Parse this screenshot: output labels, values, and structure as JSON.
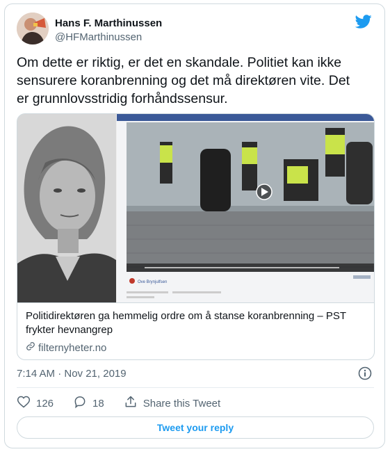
{
  "author": {
    "name": "Hans F. Marthinussen",
    "handle": "@HFMarthinussen"
  },
  "tweet": {
    "text": "Om dette er riktig, er det en skandale. Politiet kan ikke sensurere koranbrenning og det må direktøren vite. Det er grunnlovsstridig forhåndssensur."
  },
  "link_card": {
    "title": "Politidirektøren ga hemmelig ordre om å stanse koranbrenning – PST frykter hevnangrep",
    "domain": "filternyheter.no",
    "video_caption": "Ove Brynjulfsen"
  },
  "meta": {
    "time": "7:14 AM · Nov 21, 2019"
  },
  "actions": {
    "likes": "126",
    "replies": "18",
    "share_label": "Share this Tweet"
  },
  "reply_button_label": "Tweet your reply",
  "colors": {
    "brand": "#1d9bf0",
    "text": "#0f1419",
    "secondary": "#536471",
    "border": "#cfd9de"
  }
}
